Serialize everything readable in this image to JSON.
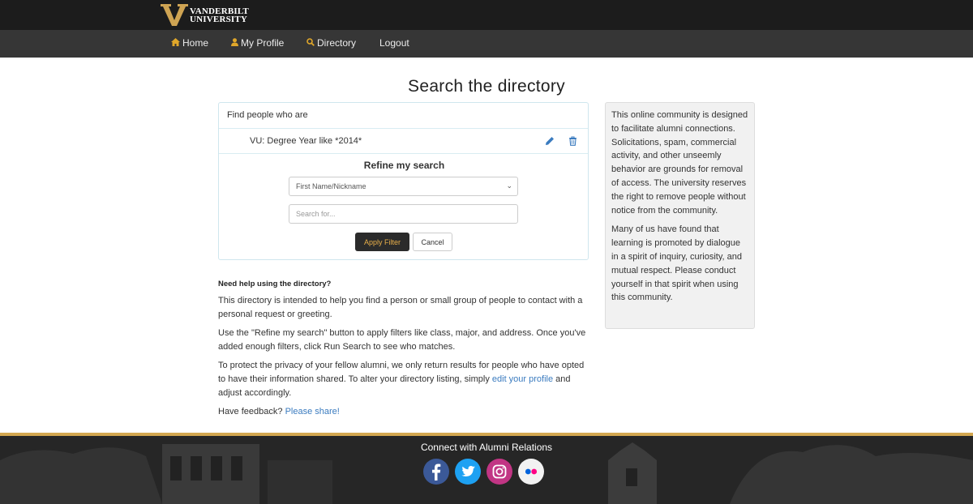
{
  "header": {
    "logo_line1": "VANDERBILT",
    "logo_line2": "UNIVERSITY"
  },
  "nav": {
    "items": [
      {
        "label": "Home",
        "icon": "home-icon"
      },
      {
        "label": "My Profile",
        "icon": "user-icon"
      },
      {
        "label": "Directory",
        "icon": "search-icon"
      },
      {
        "label": "Logout",
        "icon": ""
      }
    ]
  },
  "page": {
    "title": "Search the directory"
  },
  "search_panel": {
    "heading": "Find people who are",
    "filter": "VU: Degree Year like *2014*",
    "refine_title": "Refine my search",
    "field_select": "First Name/Nickname",
    "search_placeholder": "Search for...",
    "apply_label": "Apply Filter",
    "cancel_label": "Cancel"
  },
  "help": {
    "title": "Need help using the directory?",
    "p1": "This directory is intended to help you find a person or small group of people to contact with a personal request or greeting.",
    "p2": "Use the \"Refine my search\" button to apply filters like class, major, and address. Once you've added enough filters, click Run Search to see who matches.",
    "p3_pre": "To protect the privacy of your fellow alumni, we only return results for people who have opted to have their information shared. To alter your directory listing, simply ",
    "p3_link": "edit your profile",
    "p3_post": " and adjust accordingly.",
    "p4_pre": "Have feedback? ",
    "p4_link": "Please share!"
  },
  "sidebar": {
    "p1": "This online community is designed to facilitate alumni connections. Solicitations, spam, commercial activity, and other unseemly behavior are grounds for removal of access. The university reserves the right to remove people without notice from the community.",
    "p2": "Many of us have found that learning is promoted by dialogue in a spirit of inquiry, curiosity, and mutual respect. Please conduct yourself in that spirit when using this community."
  },
  "footer": {
    "title": "Connect with Alumni Relations",
    "social": [
      "facebook-icon",
      "twitter-icon",
      "instagram-icon",
      "flickr-icon"
    ]
  },
  "colors": {
    "brand_gold": "#d3a750",
    "topbar": "#1c1c1c",
    "navbar": "#363636",
    "link": "#3a7bbf",
    "facebook": "#3b5998",
    "twitter": "#1da1f2",
    "instagram": "#c13584",
    "flickr_blue": "#0063dc",
    "flickr_pink": "#ff0084"
  }
}
